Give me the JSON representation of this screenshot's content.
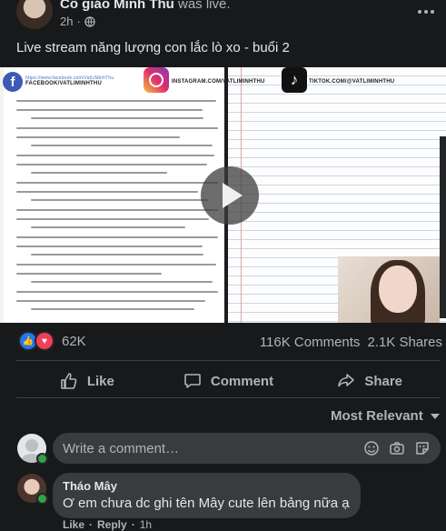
{
  "post": {
    "author": "Cô giáo Minh Thu",
    "status": "was live.",
    "time": "2h",
    "caption": "Live stream năng lượng con lắc lò xo - buổi 2"
  },
  "video": {
    "banner_fb": "FACEBOOK/VATLIMINHTHU",
    "banner_fb_url": "https://www.facebook.com/VatLiMinhThu",
    "banner_ig": "INSTAGRAM.COM/VATLIMINHTHU",
    "banner_tt": "TIKTOK.COM/@VATLIMINHTHU"
  },
  "reactions": {
    "count": "62K",
    "comments": "116K Comments",
    "shares": "2.1K Shares"
  },
  "actions": {
    "like": "Like",
    "comment": "Comment",
    "share": "Share"
  },
  "sort": {
    "label": "Most Relevant"
  },
  "composer": {
    "placeholder": "Write a comment…"
  },
  "comment": {
    "name": "Tháo Mây",
    "text": "Ơ em chưa dc ghi tên Mây cute lên bảng nữa ạ",
    "like": "Like",
    "reply": "Reply",
    "time": "1h"
  },
  "colors": {
    "background": "#18191a",
    "like_blue": "#2078f4",
    "love_red": "#f33e58",
    "online_green": "#31a24c"
  }
}
